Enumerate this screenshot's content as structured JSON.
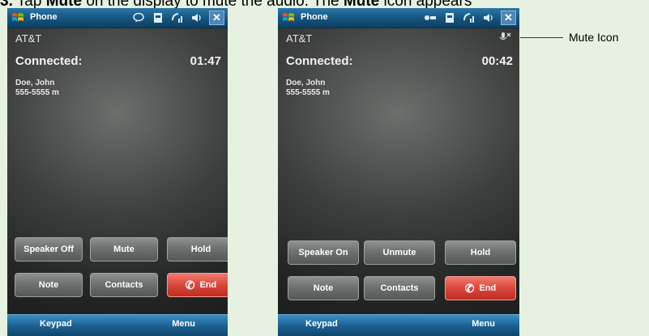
{
  "instruction": {
    "step_number": "3.",
    "text_parts": [
      "Tap ",
      "Mute",
      " on the display to mute the audio. The ",
      "Mute",
      " icon appears"
    ]
  },
  "screens": [
    {
      "title": "Phone",
      "carrier": "AT&T",
      "status": "Connected:",
      "timer": "01:47",
      "contact_name": "Doe, John",
      "contact_number": "555-5555 m",
      "buttons": {
        "speaker": "Speaker Off",
        "mute": "Mute",
        "hold": "Hold",
        "note": "Note",
        "contacts": "Contacts",
        "end": "End"
      },
      "softkeys": {
        "left": "Keypad",
        "right": "Menu"
      }
    },
    {
      "title": "Phone",
      "carrier": "AT&T",
      "status": "Connected:",
      "timer": "00:42",
      "contact_name": "Doe, John",
      "contact_number": "555-5555 m",
      "buttons": {
        "speaker": "Speaker On",
        "mute": "Unmute",
        "hold": "Hold",
        "note": "Note",
        "contacts": "Contacts",
        "end": "End"
      },
      "softkeys": {
        "left": "Keypad",
        "right": "Menu"
      }
    }
  ],
  "callout": {
    "label": "Mute Icon"
  },
  "icons": {
    "start": "windows-logo-icon",
    "message": "speech-bubble-icon",
    "battery": "battery-icon",
    "signal": "signal-icon",
    "volume": "speaker-volume-icon",
    "close": "close-icon",
    "mute": "microphone-muted-icon",
    "call": "phone-handset-icon"
  },
  "colors": {
    "titlebar": "#14537e",
    "end_button": "#dc4b3f",
    "background": "#e6f1e2"
  }
}
